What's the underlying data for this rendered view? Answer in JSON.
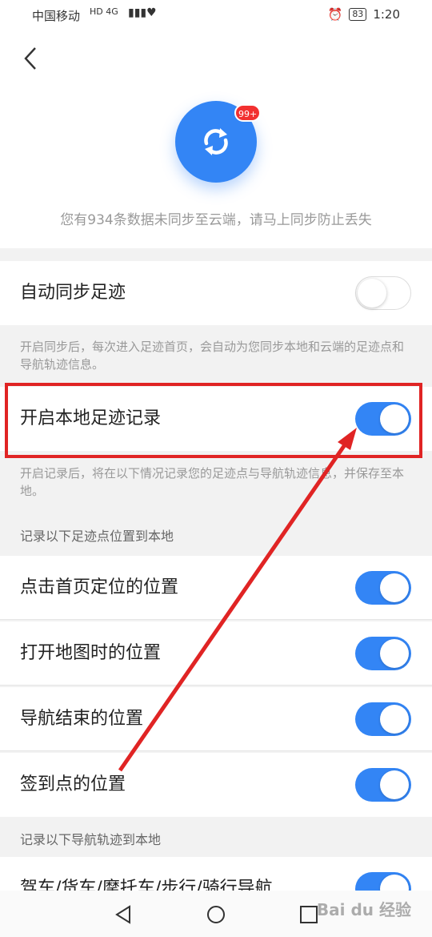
{
  "status_bar": {
    "carrier": "中国移动",
    "network": "HD 4G",
    "battery": "83",
    "time": "1:20"
  },
  "header": {
    "back_icon": "chevron-left-icon",
    "sync_icon": "sync-icon",
    "badge": "99+",
    "message": "您有934条数据未同步至云端，请马上同步防止丢失"
  },
  "settings": {
    "auto_sync": {
      "label": "自动同步足迹",
      "on": false
    },
    "auto_sync_note": "开启同步后，每次进入足迹首页，会自动为您同步本地和云端的足迹点和导航轨迹信息。",
    "local_record": {
      "label": "开启本地足迹记录",
      "on": true
    },
    "local_record_note": "开启记录后，将在以下情况记录您的足迹点与导航轨迹信息，并保存至本地。",
    "points_section": "记录以下足迹点位置到本地",
    "points": [
      {
        "label": "点击首页定位的位置",
        "on": true
      },
      {
        "label": "打开地图时的位置",
        "on": true
      },
      {
        "label": "导航结束的位置",
        "on": true
      },
      {
        "label": "签到点的位置",
        "on": true
      }
    ],
    "tracks_section": "记录以下导航轨迹到本地",
    "tracks": [
      {
        "label": "驾车/货车/摩托车/步行/骑行导航",
        "on": true
      }
    ]
  },
  "colors": {
    "accent": "#3385f5",
    "badge": "#f23030",
    "annotation": "#e02424"
  },
  "nav_bar": {
    "back_icon": "triangle-back-icon",
    "home_icon": "circle-home-icon",
    "recents_icon": "square-recents-icon"
  },
  "watermark": "Bai du 经验"
}
